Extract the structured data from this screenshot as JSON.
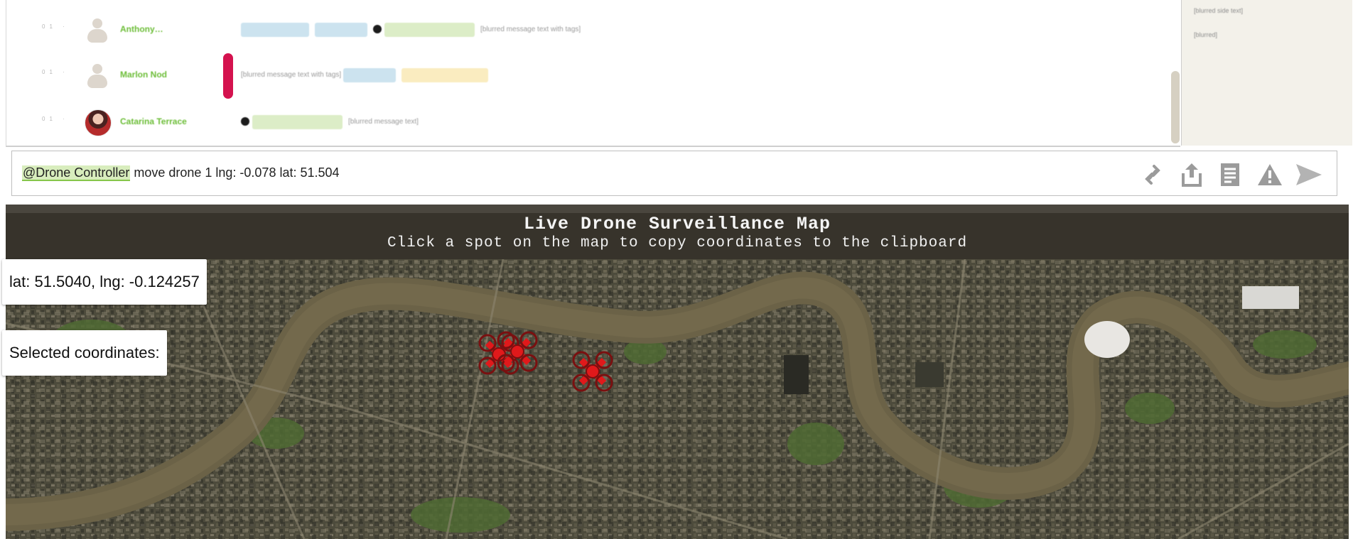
{
  "chat": {
    "messages": [
      {
        "meta": "01 ·",
        "username": "Anthony…",
        "avatar": "placeholder-avatar-icon",
        "content": "[blurred message text with tags]"
      },
      {
        "meta": "01 ·",
        "username": "Marlon Nod",
        "avatar": "placeholder-avatar-icon",
        "content": "[blurred message text with tags]"
      },
      {
        "meta": "01 ·",
        "username": "Catarina Terrace",
        "avatar": "photo-avatar",
        "content": "[blurred message text]"
      }
    ],
    "sidebar_lines": [
      "[blurred side text]",
      "[blurred]"
    ]
  },
  "compose": {
    "mention": "@Drone Controller",
    "text": " move drone 1 lng: -0.078 lat: 51.504",
    "buttons": [
      "link-icon",
      "upload-icon",
      "document-icon",
      "warning-icon",
      "send-icon"
    ]
  },
  "map": {
    "title": "Live Drone Surveillance Map",
    "subtitle": "Click a spot on the map to copy coordinates to the clipboard",
    "live_coords": "lat: 51.5040, lng: -0.124257",
    "selected_label": "Selected coordinates:",
    "drone_count": 3,
    "colors": {
      "land": "#4b4a3a",
      "river": "#6b6247",
      "drone": "#e0191b"
    }
  }
}
